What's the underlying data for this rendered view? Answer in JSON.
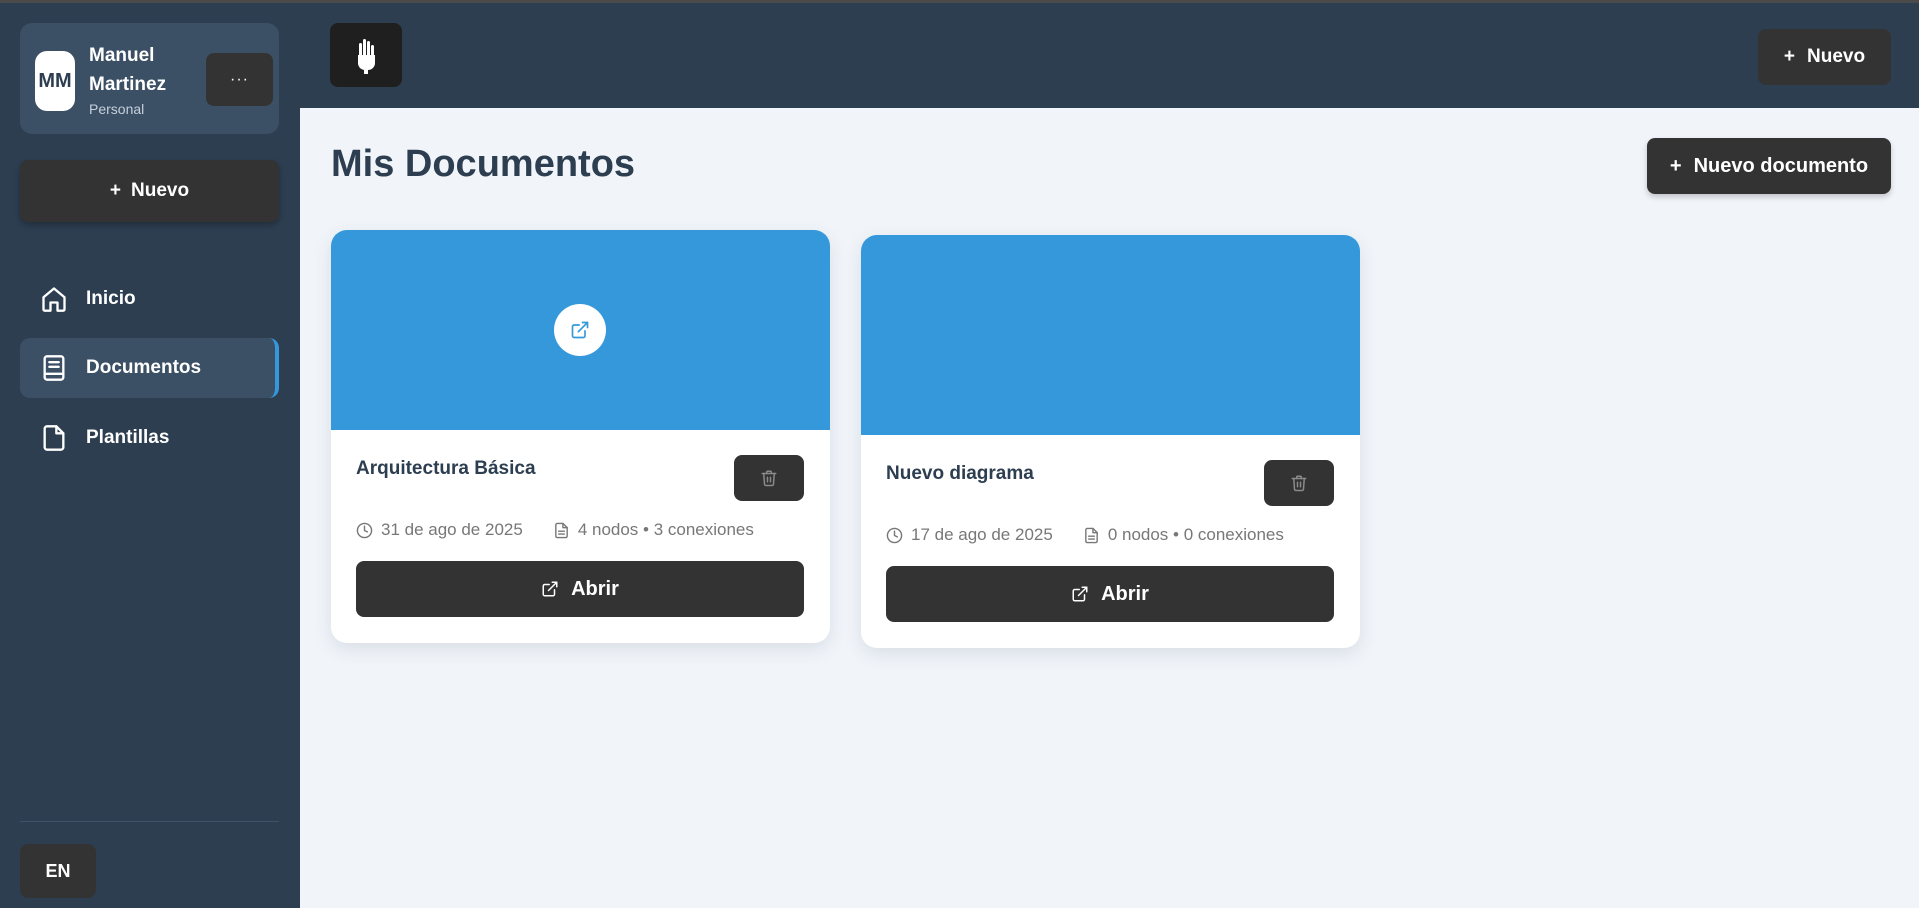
{
  "user": {
    "initials": "MM",
    "name": "Manuel Martinez",
    "plan": "Personal",
    "more_label": "···"
  },
  "sidebar": {
    "new_label": "Nuevo",
    "items": [
      {
        "label": "Inicio",
        "icon": "home-icon"
      },
      {
        "label": "Documentos",
        "icon": "book-icon",
        "active": true
      },
      {
        "label": "Plantillas",
        "icon": "file-icon"
      }
    ],
    "language": "EN"
  },
  "topbar": {
    "logo_icon": "hand-logo-icon",
    "new_label": "Nuevo"
  },
  "main": {
    "title": "Mis Documentos",
    "new_document_label": "Nuevo documento"
  },
  "documents": [
    {
      "title": "Arquitectura Básica",
      "date": "31 de ago de 2025",
      "stats": "4 nodos • 3 conexiones",
      "open_label": "Abrir"
    },
    {
      "title": "Nuevo diagrama",
      "date": "17 de ago de 2025",
      "stats": "0 nodos • 0 conexiones",
      "open_label": "Abrir"
    }
  ],
  "colors": {
    "sidebar_bg": "#2c3e50",
    "accent": "#3598db",
    "button_dark": "#333333",
    "page_bg": "#f1f5fa"
  }
}
